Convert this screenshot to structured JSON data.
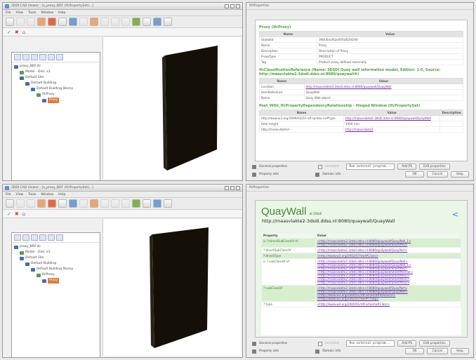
{
  "app": {
    "title": "3DDI CAD Viewer - [x_proxy_BDF (IfcPropertySet)...]",
    "title_b": "3DDI CAD Viewer - [x_proxy_BDF (IfcPropertySet)...]",
    "menu": [
      "File",
      "View",
      "Tools",
      "Window",
      "Help"
    ],
    "toolbar_icons": [
      "open-icon",
      "save-icon",
      "reset-icon",
      "zoom-icon",
      "pan-icon",
      "rotate-icon",
      "fit-icon",
      "select-icon"
    ]
  },
  "tree": {
    "nodes": [
      {
        "label": "proxy_BDF.ifc",
        "indent": 0
      },
      {
        "label": "Model - Dim: x3",
        "indent": 1
      },
      {
        "label": "Default Site",
        "indent": 1
      },
      {
        "label": "Default Building",
        "indent": 2
      },
      {
        "label": "Default Building Storey",
        "indent": 3
      },
      {
        "label": "IfcProxy",
        "indent": 4
      },
      {
        "label": "Proxy",
        "indent": 5,
        "selected": true
      }
    ]
  },
  "props_window": {
    "title": "IfcProperties",
    "sections": [
      {
        "title": "Proxy (IfcProxy)",
        "headers": [
          "Name",
          "Value"
        ],
        "rows": [
          [
            "GlobalId",
            "3Ni4i6xsXfpe0Y0U02H2H4"
          ],
          [
            "Name",
            "Proxy"
          ],
          [
            "Description",
            "Description of Proxy"
          ],
          [
            "ProxyType",
            "PRODUCT"
          ],
          [
            "Tag",
            "Product proxy defined externally"
          ]
        ]
      },
      {
        "title": "IfcClassificationReference (Name: 3DSDI Quay wall information model, Edition: 1.0, Source: http://maasvlakte2-3dsdi.ddss.nl:8080/quaywall#)",
        "headers": [
          "Name",
          "Value"
        ],
        "rows": [
          [
            "Location",
            "http://maasvlakte2-3dsdi.ddss.nl:8080/quaywall/QuayWall"
          ],
          [
            "ItemReference",
            "QuayWall"
          ],
          [
            "Name",
            "Quay Wall object"
          ]
        ]
      },
      {
        "title": "Pset_With_IfcPropertyDependencyRelationship - Hinged Window (IfcPropertySet)",
        "headers": [
          "Name",
          "Value",
          "Description"
        ],
        "rows": [
          [
            "http://www.w3.org/1999/02/22-rdf-syntax-ns#type",
            "http://maasvlakte2-3dsdi.ddss.nl:8080/quaywall/QuayWall",
            ""
          ],
          [
            "total height",
            "1500 mm",
            ""
          ],
          [
            "http://maasvlakte2-",
            "http://maasvlakte2",
            ""
          ]
        ]
      }
    ],
    "general_properties": "General properties",
    "inherited": "Inherited",
    "property_sets": "Property sets",
    "domain_info": "Domain info",
    "external_field": "Run external program...",
    "add_ps": "Add PS",
    "edit_properties": "Edit properties",
    "ok": "OK",
    "cancel": "Cancel",
    "help": "Help"
  },
  "quaywall_window": {
    "title": "IfcProperties",
    "heading": "QuayWall",
    "heading_suffix": "at 3dsdi",
    "uri": "http://maasvlakte2-3dsdi.ddss.nl:8080/quaywall/QuayWall",
    "columns": [
      "Property",
      "Value"
    ],
    "rows": [
      {
        "prop": "is ?:directSubClassOf of",
        "values": [
          "<http://maasvlakte2-3dsdi.ddss.nl:8080/quaywall/QuayWall_1>",
          "<http://maasvlakte2-3dsdi.ddss.nl:8080/quaywall/SheetPile>"
        ],
        "green": true
      },
      {
        "prop": "?:directSubClassOf",
        "values": [
          "<http://maasvlakte2-3dsdi.ddss.nl:8080/quaywall/QuayPart>"
        ],
        "green": false
      },
      {
        "prop": "?:directType",
        "values": [
          "<http://www.w3.org/2002/07/owl#Class>"
        ],
        "green": true
      },
      {
        "prop": "is ?:subClassOf of",
        "values": [
          "<http://maasvlakte2-3dsdi.ddss.nl:8080/quaywall/QuayWall>",
          "<http://maasvlakte2-3dsdi.ddss.nl:8080/quaywall/QuayWall_1>",
          "<http://maasvlakte2-3dsdi.ddss.nl:8080/quaywall/SheetPile>",
          "<http://maasvlakte2-3dsdi.ddss.nl:8080/quaywall/SheetPileFlat>",
          "<http://maasvlakte2-3dsdi.ddss.nl:8080/quaywall/SheetPileZ>",
          "<http://maasvlakte2-3dsdi.ddss.nl:8080/quaywall/SheetPileU>",
          "<http://maasvlakte2-3dsdi.ddss.nl:8080/quaywall/SheetPile2>"
        ],
        "green": false
      },
      {
        "prop": "?:subClassOf",
        "values": [
          "<http://maasvlakte2-3dsdi.ddss.nl:8080/quaywall/QuayPart>",
          "<http://maasvlakte2-3dsdi.ddss.nl:8080/quaywall/QuayWall>",
          "<http://www.w3.org/2000/01/rdf-schema#Resource>",
          "<http://www.w3.org/2002/07/owl#Thing>"
        ],
        "green": true
      },
      {
        "prop": "?:type",
        "values": [
          "<http://www.w3.org/2000/01/rdf-schema#Class>"
        ],
        "green": false
      }
    ]
  }
}
